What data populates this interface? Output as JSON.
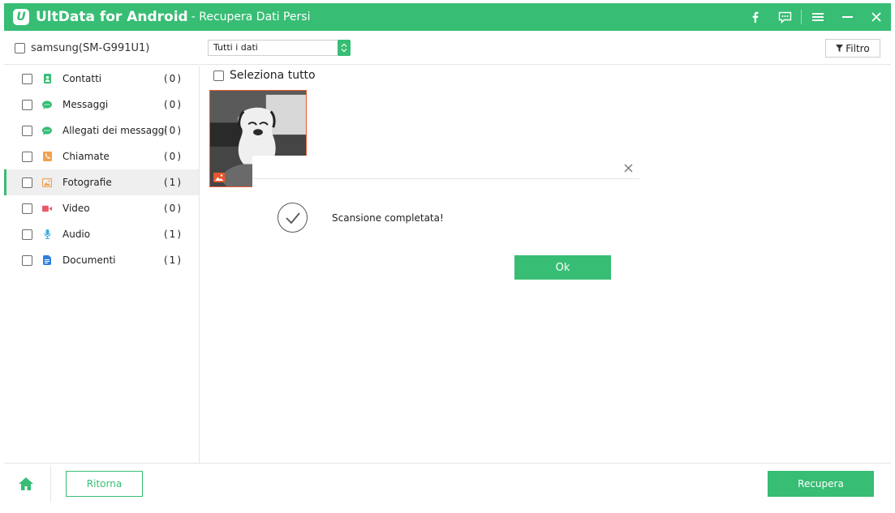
{
  "window": {
    "app_name": "UltData for Android",
    "subtitle": "- Recupera Dati Persi",
    "logo_letter": "U",
    "icons": [
      "facebook-icon",
      "feedback-icon",
      "menu-icon",
      "minimize-icon",
      "close-icon"
    ]
  },
  "device": {
    "name": "samsung(SM-G991U1)"
  },
  "sidebar": {
    "items": [
      {
        "label": "Contatti",
        "count": "(0)",
        "icon": "contacts-icon",
        "color": "#37bd74"
      },
      {
        "label": "Messaggi",
        "count": "(0)",
        "icon": "messages-icon",
        "color": "#37bd74"
      },
      {
        "label": "Allegati dei messaggi",
        "count": "(0)",
        "icon": "message-attachments-icon",
        "color": "#37bd74"
      },
      {
        "label": "Chiamate",
        "count": "(0)",
        "icon": "calls-icon",
        "color": "#f0a050"
      },
      {
        "label": "Fotografie",
        "count": "(1)",
        "icon": "photos-icon",
        "color": "#f0a050"
      },
      {
        "label": "Video",
        "count": "(0)",
        "icon": "video-icon",
        "color": "#e85a6a"
      },
      {
        "label": "Audio",
        "count": "(1)",
        "icon": "audio-icon",
        "color": "#3aaee0"
      },
      {
        "label": "Documenti",
        "count": "(1)",
        "icon": "documents-icon",
        "color": "#2f7fe0"
      }
    ],
    "active_index": 4
  },
  "toolbar": {
    "filter_select_value": "Tutti i dati",
    "filter_button_label": "Filtro"
  },
  "content": {
    "select_all_label": "Seleziona tutto"
  },
  "dialog": {
    "message": "Scansione completata!",
    "ok_label": "Ok"
  },
  "bottom": {
    "back_label": "Ritorna",
    "recover_label": "Recupera"
  },
  "colors": {
    "accent": "#37bd74",
    "photo_border": "#e8582f"
  }
}
